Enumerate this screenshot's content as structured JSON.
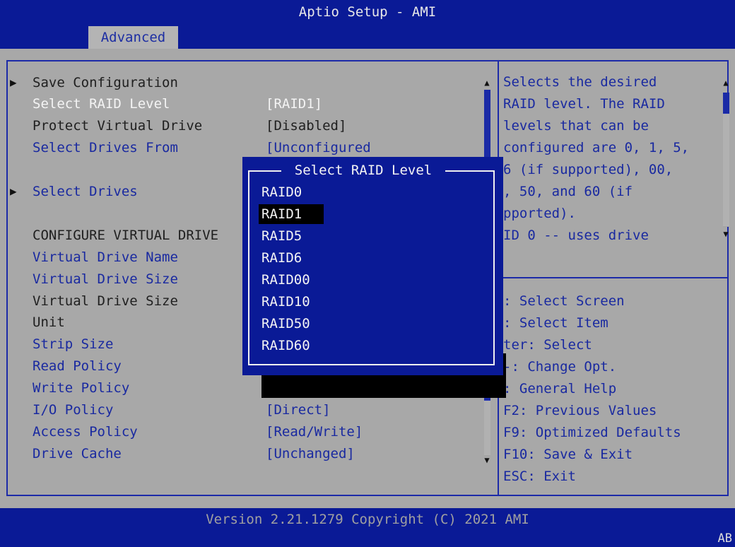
{
  "title": "Aptio Setup - AMI",
  "tab": "Advanced",
  "menu": [
    {
      "label": "Save Configuration",
      "value": "",
      "submenu": true
    },
    {
      "label": "Select RAID Level",
      "value": "[RAID1]",
      "submenu": false
    },
    {
      "label": "Protect Virtual Drive",
      "value": "[Disabled]",
      "submenu": false
    },
    {
      "label": "Select Drives From",
      "value": "[Unconfigured",
      "submenu": false
    },
    {
      "label": "Select Drives",
      "value": "",
      "submenu": true
    },
    {
      "label": "CONFIGURE VIRTUAL DRIVE",
      "value": "",
      "submenu": false
    },
    {
      "label": "Virtual Drive Name",
      "value": "",
      "submenu": false
    },
    {
      "label": "Virtual Drive Size",
      "value": "",
      "submenu": false
    },
    {
      "label": "Virtual Drive Size",
      "value": "",
      "submenu": false
    },
    {
      "label": "Unit",
      "value": "",
      "submenu": false
    },
    {
      "label": "Strip Size",
      "value": "",
      "submenu": false
    },
    {
      "label": "Read Policy",
      "value": "",
      "submenu": false
    },
    {
      "label": "Write Policy",
      "value": "",
      "submenu": false
    },
    {
      "label": "I/O Policy",
      "value": "[Direct]",
      "submenu": false
    },
    {
      "label": "Access Policy",
      "value": "[Read/Write]",
      "submenu": false
    },
    {
      "label": "Drive Cache",
      "value": "[Unchanged]",
      "submenu": false
    }
  ],
  "help": {
    "lines": [
      "Selects the desired",
      "RAID level. The RAID",
      "levels that can be",
      "configured are 0, 1, 5,",
      "6 (if supported), 00,",
      ", 50, and 60 (if",
      "pported).",
      "ID 0 -- uses drive"
    ],
    "keys": [
      ": Select Screen",
      ": Select Item",
      "ter: Select",
      "-: Change Opt.",
      ": General Help",
      "F2: Previous Values",
      "F9: Optimized Defaults",
      "F10: Save & Exit",
      "ESC: Exit"
    ]
  },
  "popup": {
    "title": "Select RAID Level",
    "options": [
      "RAID0",
      "RAID1",
      "RAID5",
      "RAID6",
      "RAID00",
      "RAID10",
      "RAID50",
      "RAID60"
    ],
    "selected": "RAID1"
  },
  "footer": {
    "version": "Version 2.21.1279 Copyright (C) 2021 AMI",
    "corner": "AB"
  },
  "icons": {
    "submenu": "triangle-right-icon",
    "scroll_up": "triangle-up-icon",
    "scroll_down": "triangle-down-icon"
  },
  "colors": {
    "bios_blue": "#0a1a96",
    "panel_gray": "#a8a8a8",
    "label_blue": "#1929a0",
    "highlight_white": "#f4f4f4"
  }
}
